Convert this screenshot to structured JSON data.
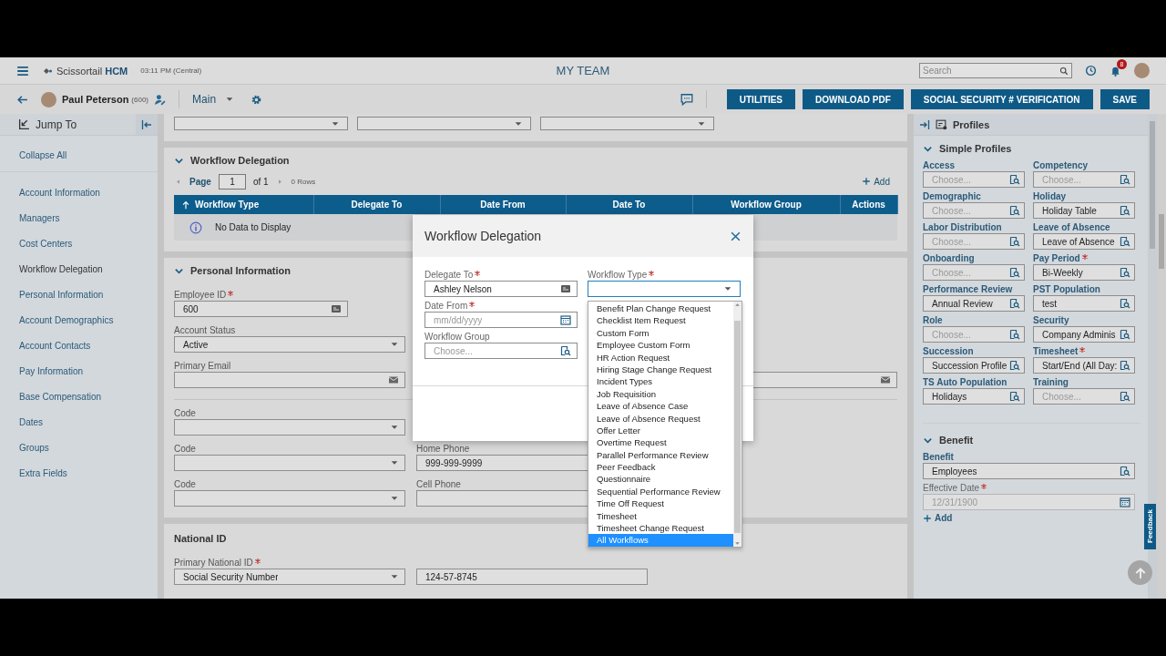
{
  "header": {
    "brand": "Scissortail **HCM**",
    "time": "03:11 PM (Central)",
    "title": "MY TEAM",
    "search": {
      "placeholder": "Search"
    },
    "notifications": "8"
  },
  "toolbar": {
    "employee": "Paul Peterson",
    "employee_id": "(600)",
    "view": "Main",
    "buttons": [
      "UTILITIES",
      "DOWNLOAD PDF",
      "SOCIAL SECURITY # VERIFICATION",
      "SAVE"
    ]
  },
  "sidebar": {
    "title": "Jump To",
    "collapse": "Collapse All",
    "items": [
      {
        "label": "Account Information",
        "selected": false
      },
      {
        "label": "Managers",
        "selected": false
      },
      {
        "label": "Cost Centers",
        "selected": false
      },
      {
        "label": "Workflow Delegation",
        "selected": true
      },
      {
        "label": "Personal Information",
        "selected": false
      },
      {
        "label": "Account Demographics",
        "selected": false
      },
      {
        "label": "Account Contacts",
        "selected": false
      },
      {
        "label": "Pay Information",
        "selected": false
      },
      {
        "label": "Base Compensation",
        "selected": false
      },
      {
        "label": "Dates",
        "selected": false
      },
      {
        "label": "Groups",
        "selected": false
      },
      {
        "label": "Extra Fields",
        "selected": false
      }
    ]
  },
  "workflow_delegation": {
    "title": "Workflow Delegation",
    "pager": {
      "label": "Page",
      "page": "1",
      "of": "of 1",
      "rows": "0 Rows"
    },
    "add": "Add",
    "columns": [
      "Workflow Type",
      "Delegate To",
      "Date From",
      "Date To",
      "Workflow Group",
      "Actions"
    ],
    "empty": "No Data to Display"
  },
  "personal_information": {
    "title": "Personal Information",
    "rows": [
      [
        {
          "kind": "id",
          "label": "Employee ID",
          "required": true,
          "value": "600"
        }
      ],
      [
        {
          "kind": "select",
          "label": "Account Status",
          "required": false,
          "value": "Active"
        }
      ],
      [
        {
          "kind": "email",
          "label": "Primary Email",
          "required": false
        },
        {
          "kind": "email"
        }
      ],
      [
        {
          "kind": "select",
          "label": "Code",
          "required": false
        }
      ],
      [
        {
          "kind": "select",
          "label": "Code",
          "required": false
        },
        {
          "kind": "text",
          "label": "Home Phone",
          "required": false,
          "value": "999-999-9999"
        }
      ],
      [
        {
          "kind": "select",
          "label": "Code",
          "required": false
        },
        {
          "kind": "text",
          "label": "Cell Phone",
          "required": false
        }
      ]
    ]
  },
  "national_id": {
    "title": "National ID",
    "fields": [
      {
        "kind": "select",
        "label": "Primary National ID",
        "required": true,
        "value": "Social Security Number"
      },
      {
        "kind": "text",
        "value": "124-57-8745"
      }
    ]
  },
  "profiles": {
    "title": "Profiles",
    "simple_title": "Simple Profiles",
    "fields": [
      {
        "kind": "lookup",
        "label": "Access",
        "required": false,
        "placeholder": "Choose..."
      },
      {
        "kind": "lookup",
        "label": "Competency",
        "required": false,
        "placeholder": "Choose..."
      },
      {
        "kind": "lookup",
        "label": "Demographic",
        "required": false,
        "placeholder": "Choose..."
      },
      {
        "kind": "lookup",
        "label": "Holiday",
        "required": false,
        "value": "Holiday Table"
      },
      {
        "kind": "lookup",
        "label": "Labor Distribution",
        "required": false,
        "placeholder": "Choose..."
      },
      {
        "kind": "lookup",
        "label": "Leave of Absence",
        "required": false,
        "value": "Leave of Absence"
      },
      {
        "kind": "lookup",
        "label": "Onboarding",
        "required": false,
        "placeholder": "Choose..."
      },
      {
        "kind": "lookup",
        "label": "Pay Period",
        "required": true,
        "value": "Bi-Weekly"
      },
      {
        "kind": "lookup",
        "label": "Performance Review",
        "required": false,
        "value": "Annual Review"
      },
      {
        "kind": "lookup",
        "label": "PST Population",
        "required": false,
        "value": "test"
      },
      {
        "kind": "lookup",
        "label": "Role",
        "required": false,
        "placeholder": "Choose..."
      },
      {
        "kind": "lookup",
        "label": "Security",
        "required": false,
        "value": "Company Adminis"
      },
      {
        "kind": "lookup",
        "label": "Succession",
        "required": false,
        "value": "Succession Profile"
      },
      {
        "kind": "lookup",
        "label": "Timesheet",
        "required": true,
        "value": "Start/End (All Day:"
      },
      {
        "kind": "lookup",
        "label": "TS Auto Population",
        "required": false,
        "value": "Holidays"
      },
      {
        "kind": "lookup",
        "label": "Training",
        "required": false,
        "placeholder": "Choose..."
      }
    ],
    "benefit": {
      "title": "Benefit",
      "fields": [
        {
          "kind": "lookup",
          "label": "Benefit",
          "required": false,
          "value": "Employees",
          "disabled": false
        },
        {
          "kind": "date",
          "label": "Effective Date",
          "required": true,
          "value": "12/31/1900",
          "disabled": true
        }
      ],
      "add": "Add"
    },
    "feedback": "Feedback"
  },
  "modal": {
    "title": "Workflow Delegation",
    "fields": [
      {
        "kind": "id",
        "label": "Delegate To",
        "required": true,
        "value": "Ashley Nelson"
      },
      {
        "kind": "date",
        "label": "Date From",
        "required": true,
        "placeholder": "mm/dd/yyyy"
      },
      {
        "kind": "lookup",
        "label": "Workflow Group",
        "required": false,
        "placeholder": "Choose..."
      }
    ],
    "workflow_type": {
      "label": "Workflow Type",
      "required": true,
      "options": [
        {
          "label": "Benefit Plan Change Request",
          "selected": false
        },
        {
          "label": "Checklist Item Request",
          "selected": false
        },
        {
          "label": "Custom Form",
          "selected": false
        },
        {
          "label": "Employee Custom Form",
          "selected": false
        },
        {
          "label": "HR Action Request",
          "selected": false
        },
        {
          "label": "Hiring Stage Change Request",
          "selected": false
        },
        {
          "label": "Incident Types",
          "selected": false
        },
        {
          "label": "Job Requisition",
          "selected": false
        },
        {
          "label": "Leave of Absence Case",
          "selected": false
        },
        {
          "label": "Leave of Absence Request",
          "selected": false
        },
        {
          "label": "Offer Letter",
          "selected": false
        },
        {
          "label": "Overtime Request",
          "selected": false
        },
        {
          "label": "Parallel Performance Review",
          "selected": false
        },
        {
          "label": "Peer Feedback",
          "selected": false
        },
        {
          "label": "Questionnaire",
          "selected": false
        },
        {
          "label": "Sequential Performance Review",
          "selected": false
        },
        {
          "label": "Time Off Request",
          "selected": false
        },
        {
          "label": "Timesheet",
          "selected": false
        },
        {
          "label": "Timesheet Change Request",
          "selected": false
        },
        {
          "label": "All Workflows",
          "selected": true
        }
      ]
    }
  }
}
